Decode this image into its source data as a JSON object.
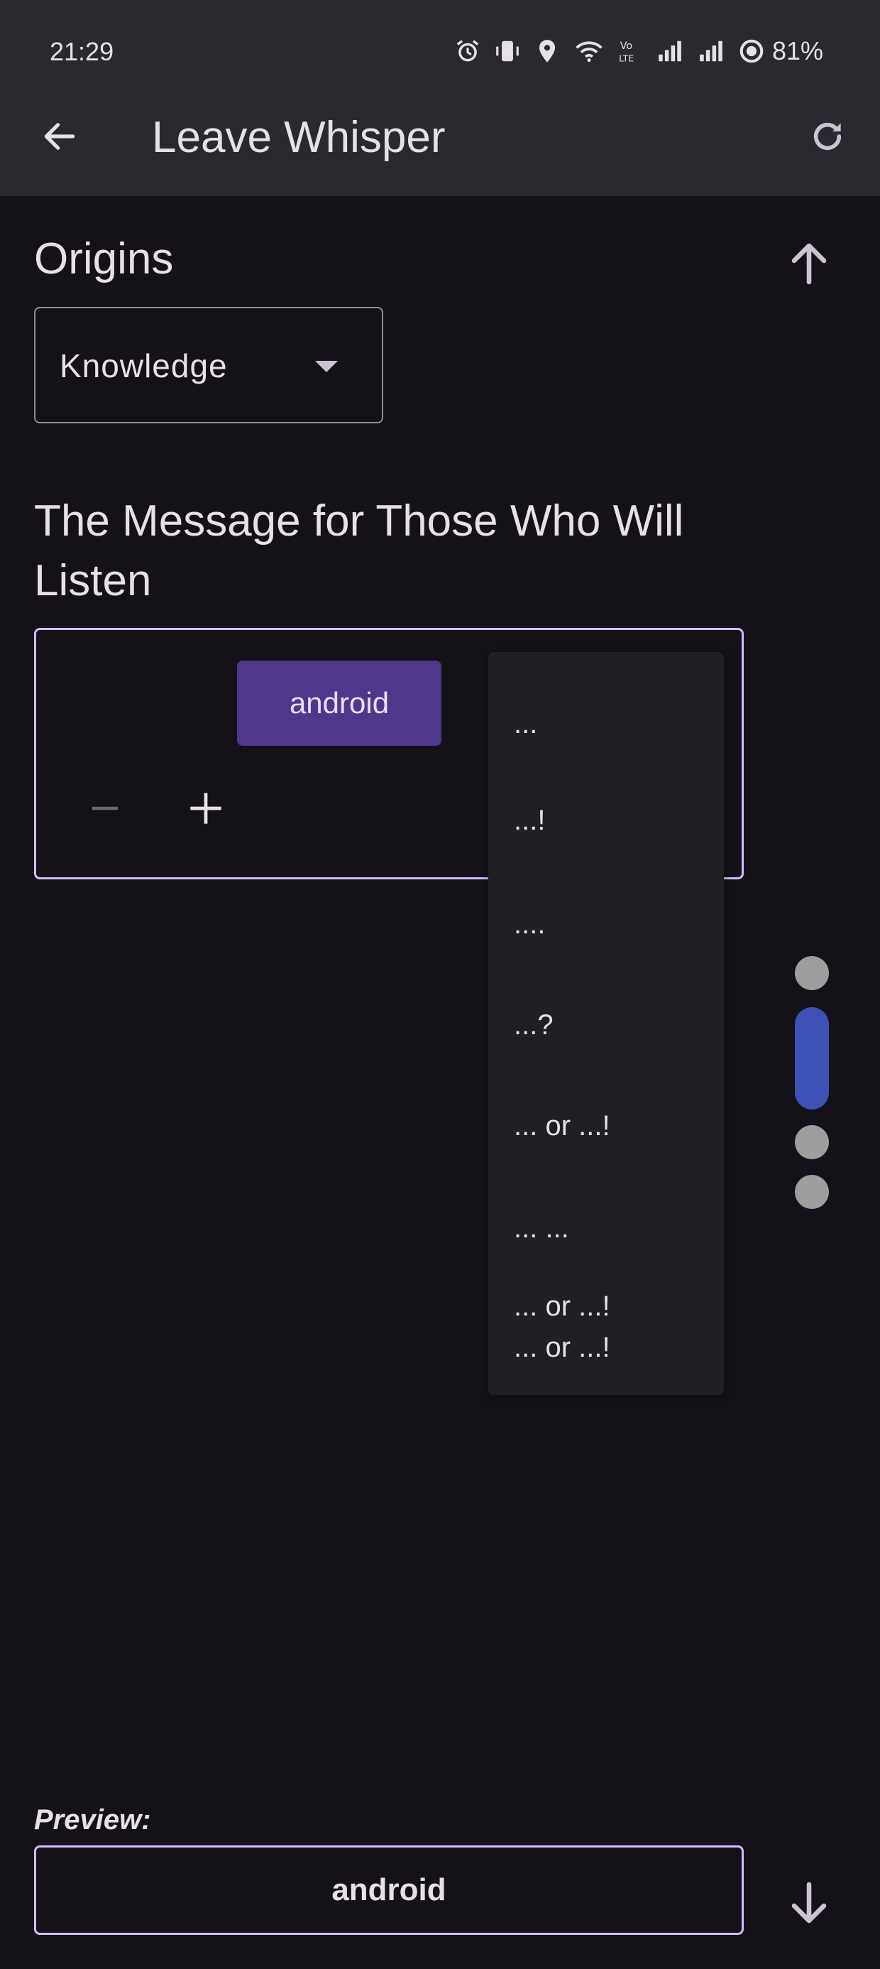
{
  "status_bar": {
    "time": "21:29",
    "battery": "81%",
    "icons": [
      "alarm-icon",
      "vibrate-icon",
      "location-icon",
      "wifi-icon",
      "volte-icon",
      "signal-icon",
      "signal-icon",
      "battery-ring-icon"
    ]
  },
  "app_bar": {
    "title": "Leave Whisper",
    "back_icon": "arrow-back-icon",
    "refresh_icon": "refresh-icon"
  },
  "origins": {
    "label": "Origins",
    "selected": "Knowledge"
  },
  "message": {
    "label": "The Message for Those Who Will Listen",
    "word_chip": "android"
  },
  "menu": {
    "items": [
      "...",
      "...!",
      "....",
      "...?",
      "... or ...!",
      "... ...",
      "... or ...!",
      "... or ...!"
    ]
  },
  "page_indicator": {
    "count": 4,
    "active_index": 1
  },
  "preview": {
    "label": "Preview:",
    "text": "android"
  },
  "colors": {
    "background": "#141218",
    "app_bar": "#2b2930",
    "accent_outline": "#d0bcff",
    "chip": "#4f378b",
    "menu_surface": "#211f26",
    "indicator_active": "#3f51b5",
    "indicator_inactive": "#9e9e9e"
  }
}
